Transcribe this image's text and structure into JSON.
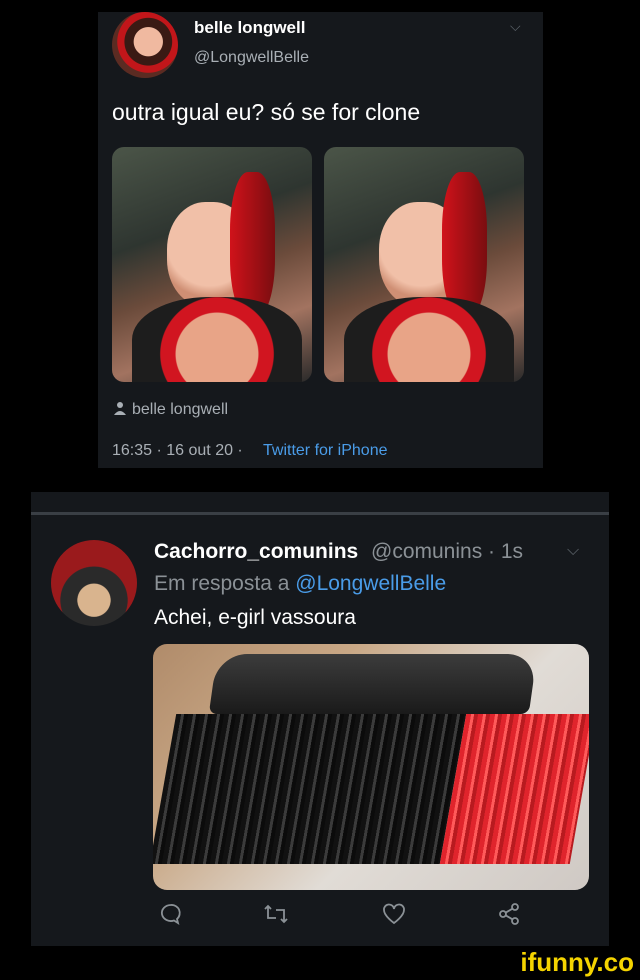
{
  "tweet1": {
    "name": "belle longwell",
    "handle": "@LongwellBelle",
    "text": "outra igual eu? só se for clone",
    "author_tag": "belle longwell",
    "time": "16:35 · 16 out 20 ·",
    "source": "Twitter for iPhone"
  },
  "tweet2": {
    "name": "Cachorro_comunins",
    "handle_time": "@comunins · 1s",
    "reply_prefix": "Em resposta a",
    "reply_handle": "@LongwellBelle",
    "text": "Achei, e-girl vassoura"
  },
  "icons": {
    "chevron": "⌵",
    "user": "👤",
    "reply": "💬",
    "retweet": "⟲",
    "like": "♡",
    "share": "⎋"
  },
  "watermark": "ifunny.co",
  "colors": {
    "link": "#4a9ce8",
    "background": "#000000",
    "card": "#15181c",
    "watermark": "#f5d400"
  }
}
